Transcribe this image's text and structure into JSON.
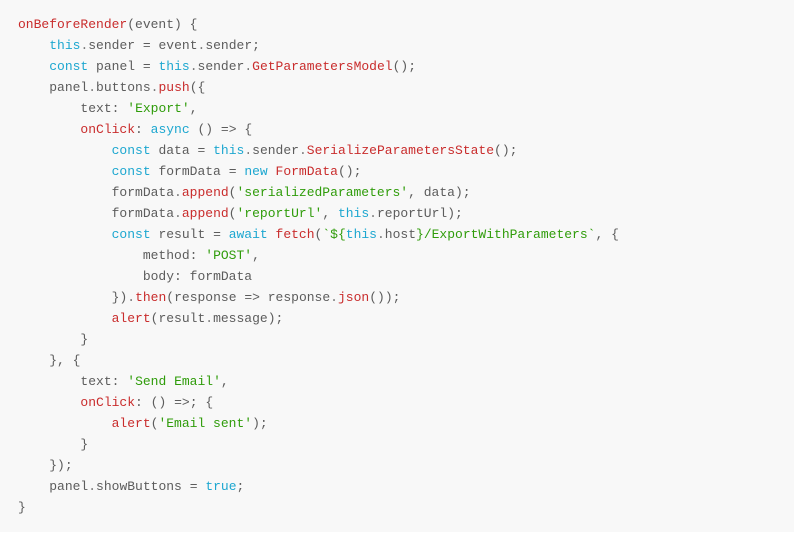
{
  "code": {
    "tokens": {
      "fn_onBeforeRender": "onBeforeRender",
      "param_event": "event",
      "kw_this": "this",
      "prop_sender": "sender",
      "kw_const": "const",
      "var_panel": "panel",
      "method_GetParametersModel": "GetParametersModel",
      "prop_buttons": "buttons",
      "method_push": "push",
      "prop_text": "text",
      "str_Export": "'Export'",
      "prop_onClick": "onClick",
      "kw_async": "async",
      "var_data": "data",
      "method_SerializeParametersState": "SerializeParametersState",
      "var_formData": "formData",
      "kw_new": "new",
      "class_FormData": "FormData",
      "method_append": "append",
      "str_serializedParameters": "'serializedParameters'",
      "str_reportUrl": "'reportUrl'",
      "prop_reportUrl": "reportUrl",
      "var_result": "result",
      "kw_await": "await",
      "fn_fetch": "fetch",
      "tmpl_start": "`${",
      "prop_host": "host",
      "tmpl_path": "}/ExportWithParameters`",
      "prop_method": "method",
      "str_POST": "'POST'",
      "prop_body": "body",
      "method_then": "then",
      "var_response": "response",
      "method_json": "json",
      "fn_alert": "alert",
      "prop_message": "message",
      "str_SendEmail": "'Send Email'",
      "str_EmailSent": "'Email sent'",
      "prop_showButtons": "showButtons",
      "kw_true": "true",
      "op_assign": "=",
      "op_arrow": "=>",
      "op_plus": "+",
      "punc_dot": ".",
      "punc_comma": ",",
      "punc_semi": ";",
      "punc_colon": ":",
      "punc_lbrace": "{",
      "punc_rbrace": "}",
      "punc_lparen": "(",
      "punc_rparen": ")",
      "indent1": "    ",
      "indent2": "        ",
      "indent3": "            ",
      "indent4": "                ",
      "space": " "
    }
  }
}
